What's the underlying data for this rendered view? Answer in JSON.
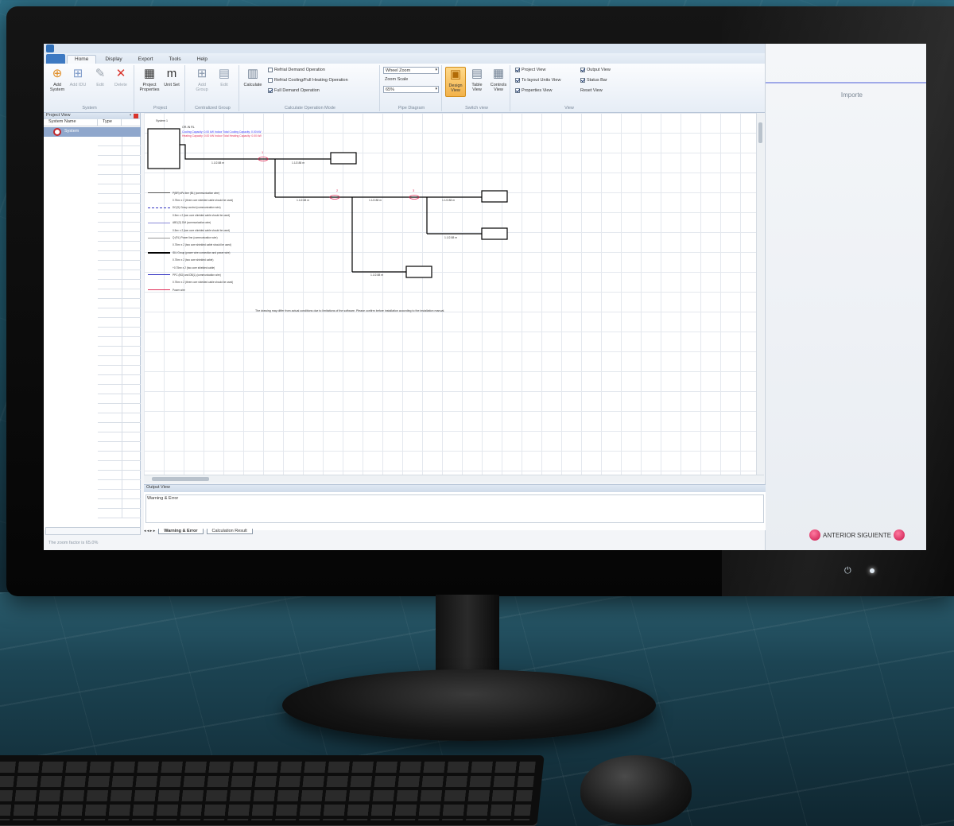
{
  "app": {
    "menu_tabs": [
      "Home",
      "Display",
      "Export",
      "Tools",
      "Help"
    ],
    "active_tab": "Home"
  },
  "ribbon": {
    "system": {
      "label": "System",
      "buttons": [
        "Add System",
        "Add IDU",
        "Edit",
        "Delete"
      ]
    },
    "project": {
      "label": "Project",
      "buttons": [
        "Project Properties",
        "Unit Set"
      ]
    },
    "centralized_group": {
      "label": "Centralized Group",
      "buttons": [
        "Add Group",
        "Edit"
      ]
    },
    "calculate": {
      "label": "Calculate Operation Mode",
      "button": "Calculate",
      "options": [
        {
          "label": "Refrial Demand Operation",
          "checked": false
        },
        {
          "label": "Refrial Cooling/Full Heating Operation",
          "checked": false
        },
        {
          "label": "Full Demand Operation",
          "checked": true
        }
      ]
    },
    "pipe_diagram": {
      "label": "Pipe Diagram",
      "zoom_mode": "Wheel Zoom",
      "zoom_scale_label": "Zoom Scale",
      "zoom_value": "65%"
    },
    "switch_view": {
      "label": "Switch view",
      "buttons": [
        "Design View",
        "Table View",
        "Controls View"
      ],
      "active": "Design View"
    },
    "view": {
      "label": "View",
      "options": [
        {
          "label": "Project View",
          "checked": true
        },
        {
          "label": "To layout Units View",
          "checked": true
        },
        {
          "label": "Properties View",
          "checked": true
        },
        {
          "label": "Output View",
          "checked": true
        },
        {
          "label": "Status Bar",
          "checked": true
        }
      ],
      "reset_label": "Reset View"
    }
  },
  "project_panel": {
    "title": "Project View",
    "columns": [
      "System Name",
      "Type"
    ],
    "systems": [
      {
        "name": "System"
      }
    ]
  },
  "diagram": {
    "outdoor_unit_label": "System 1",
    "outdoor_unit_info": "OR-IN RL",
    "capacity_line_1": "Cooling Capacity: 0.00 kW     Indoor Total Cooling Capacity: 0.00 kW",
    "capacity_line_2": "Heating Capacity: 0.00 kW     Indoor Total Heating Capacity: 0.00 kW",
    "pipe_labels": [
      "1.1/2.88 m",
      "1.1/2.88 m",
      "1.1/2.88 m",
      "1.1/2.88 m",
      "1.1/2.88 m",
      "1.1/2.88 m",
      "1.1/2.88 m"
    ],
    "legend": [
      "P(BR) kPa line (BL) (communication wire)",
      "0.75m² x 2 (three core shielded cable should be used)",
      "DC(G) Group control (communication wire)",
      "0.5m² x 2 (two core shielded cable should be used)",
      "ABC(G) DM (communication wire)",
      "0.5m² x 2 (two core shielded cable should be used)",
      "Q (RL) Power line (communication wire)",
      "0.75m² x 2 (two core shielded cable should be used)",
      "IDU Group (power wire connection and power wire)",
      "0.75m² x 2 (two core shielded cable)",
      "+0.75m² x 2 (two core shielded cable)",
      "PPC (BG) and DB(L) (communication wire)",
      "0.75m² x 2 (three core shielded cable should be used)",
      "Power wire"
    ],
    "note": "The drawing may differ from actual conditions due to limitations of the software. Please confirm before installation according to the installation manual."
  },
  "output_panel": {
    "title": "Output View",
    "content_title": "Warning & Error"
  },
  "bottom_tabs": [
    "Warning & Error",
    "Calculation Result"
  ],
  "status_bar": "The zoom factor is 65.0%",
  "right_pane": {
    "import_label": "Importe",
    "prev_label": "ANTERIOR",
    "next_label": "SIGUIENTE"
  },
  "colors": {
    "accent_blue": "#3d79c2",
    "selected_row": "#8fa7cc",
    "error_red": "#d9342b",
    "nav_pink": "#c8164a"
  }
}
